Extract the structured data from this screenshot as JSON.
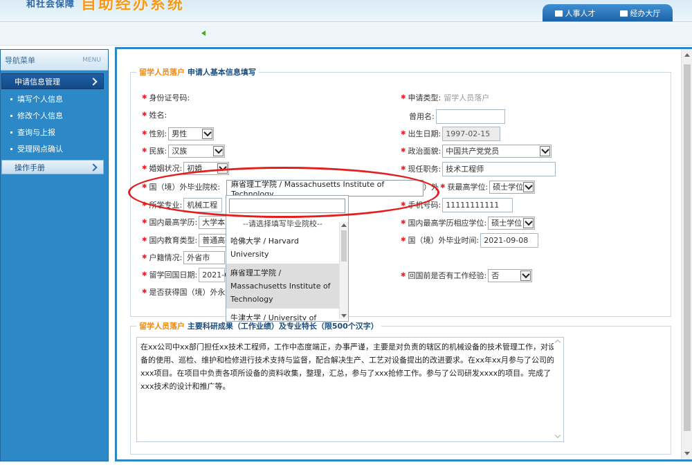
{
  "header": {
    "logo_text": "和社会保障",
    "logo_big": "自助经办系统",
    "nav": [
      {
        "label": "人事人才",
        "icon": "monitor-icon"
      },
      {
        "label": "经办大厅",
        "icon": "building-icon"
      }
    ]
  },
  "sidebar": {
    "title": "导航菜单",
    "title_en": "MENU",
    "main_menu": "申请信息管理",
    "items": [
      "填写个人信息",
      "修改个人信息",
      "查询与上报",
      "受理网点确认"
    ],
    "manual": "操作手册"
  },
  "form": {
    "legend_hl": "留学人员落户",
    "legend": "申请人基本信息填写",
    "fields": {
      "id_card": "身份证号码:",
      "apply_type_label": "申请类型:",
      "apply_type_value": "留学人员落户",
      "name": "姓名:",
      "former_name": "曾用名:",
      "gender": "性别:",
      "gender_value": "男性",
      "birth": "出生日期:",
      "birth_value": "1997-02-15",
      "ethnic": "民族:",
      "ethnic_value": "汉族",
      "political": "政治面貌:",
      "political_value": "中国共产党党员",
      "marital": "婚姻状况:",
      "marital_value": "初婚",
      "position": "现任职务:",
      "position_value": "技术工程师",
      "school": "国（境）外毕业院校:",
      "school_value": "麻省理工学院 / Massachusetts Institute of Technology",
      "degree_abroad_a": "）外",
      "degree_abroad_b": "获最高学位:",
      "degree_abroad_value": "硕士学位",
      "major": "所学专业:",
      "major_value": "机械工程",
      "phone": "手机号码:",
      "phone_value": "11111111111",
      "domestic_edu": "国内最高学历:",
      "domestic_edu_value": "大学本",
      "domestic_degree": "国内最高学历相应学位:",
      "domestic_degree_value": "硕士学位",
      "edu_type": "国内教育类型:",
      "edu_type_value": "普通高",
      "grad_time": "国（境）外毕业时间:",
      "grad_time_value": "2021-09-08",
      "household": "户籍情况:",
      "household_value": "外省市",
      "return_date": "留学回国日期:",
      "return_date_value": "2021-0",
      "work_exp": "回国前是否有工作经验:",
      "work_exp_value": "否",
      "permanent": "是否获得国（境）外永"
    }
  },
  "dropdown": {
    "placeholder": "--请选择填写毕业院校--",
    "options": [
      "哈佛大学 / Harvard University",
      "麻省理工学院 / Massachusetts Institute of Technology",
      "牛津大学 / University of Oxford"
    ]
  },
  "research": {
    "legend_hl": "留学人员落户",
    "legend": "主要科研成果（工作业绩）及专业特长（限500个汉字）",
    "text": "在xx公司中xx部门担任xx技术工程师，工作中态度端正，办事严谨，主要是对负责的辖区的机械设备的技术管理工作，对设备的使用、巡检、维护和检修进行技术支持与监督，配合解决生产、工艺对设备提出的改进要求。在xx年xx月参与了公司的xxx项目。在项目中负责各项所设备的资料收集，整理，汇总，参与了xxx抢修工作。参与了公司研发xxxx的项目。完成了xxx技术的设计和推广等。"
  },
  "colors": {
    "accent": "#2c88c6",
    "highlight_ellipse": "#e31e1e",
    "legend_orange": "#f08a10"
  }
}
